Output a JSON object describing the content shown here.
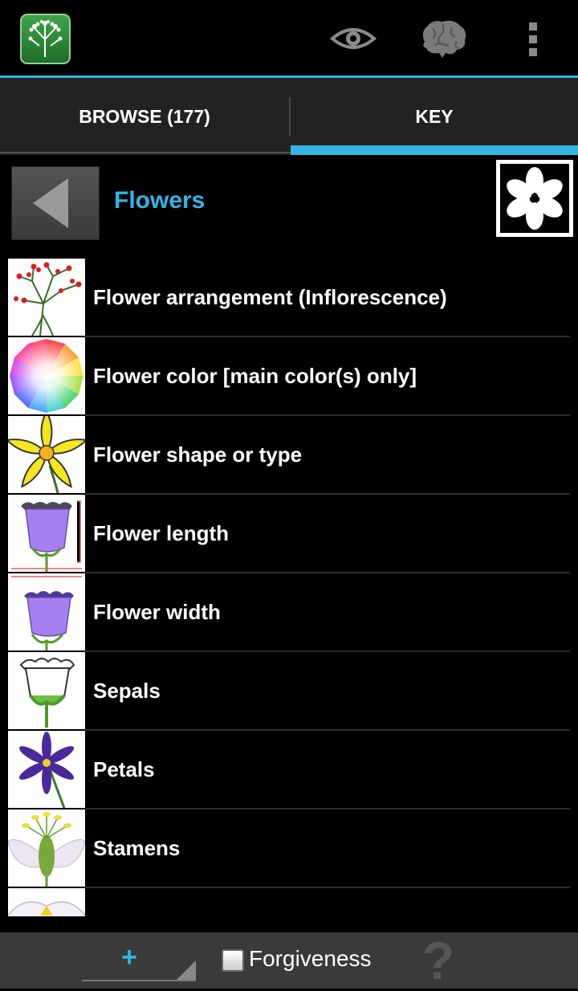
{
  "actionbar": {
    "app_icon": "flower-cluster-icon",
    "actions": [
      "eye-icon",
      "brain-icon",
      "overflow-menu-icon"
    ],
    "accent": "#33b5e5"
  },
  "tabs": [
    {
      "label": "BROWSE (177)",
      "selected": false
    },
    {
      "label": "KEY",
      "selected": true
    }
  ],
  "header": {
    "title": "Flowers",
    "back_icon": "triangle-left-icon",
    "thumb_icon": "white-flower-icon"
  },
  "list": {
    "items": [
      {
        "label": "Flower arrangement (Inflorescence)",
        "icon": "inflorescence-icon"
      },
      {
        "label": "Flower color [main color(s) only]",
        "icon": "color-wheel-icon"
      },
      {
        "label": "Flower shape or type",
        "icon": "yellow-flower-icon"
      },
      {
        "label": "Flower length",
        "icon": "bell-flower-length-icon"
      },
      {
        "label": "Flower width",
        "icon": "bell-flower-width-icon"
      },
      {
        "label": "Sepals",
        "icon": "sepals-icon"
      },
      {
        "label": "Petals",
        "icon": "petals-icon"
      },
      {
        "label": "Stamens",
        "icon": "stamens-icon"
      },
      {
        "label": "",
        "icon": "partial-flower-icon"
      }
    ]
  },
  "bottombar": {
    "add_label": "+",
    "forgiveness_label": "Forgiveness",
    "forgiveness_checked": false,
    "help_label": "?"
  }
}
